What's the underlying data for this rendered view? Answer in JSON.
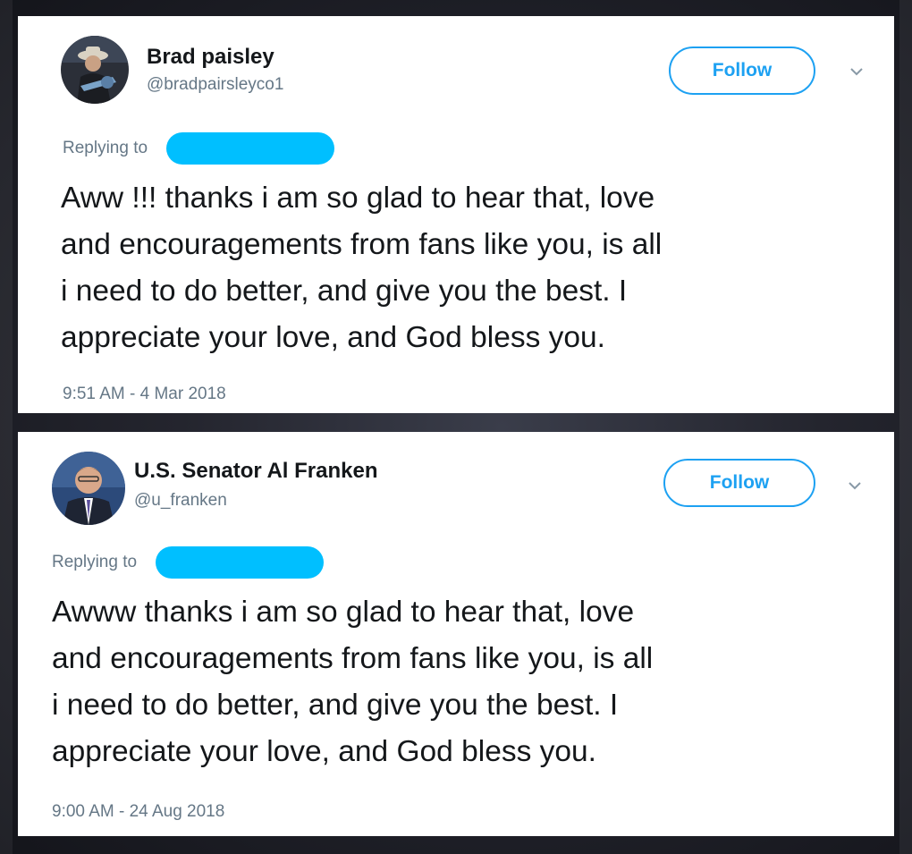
{
  "tweets": [
    {
      "display_name": "Brad paisley",
      "handle": "@bradpairsleyco1",
      "follow_label": "Follow",
      "replying_label": "Replying to",
      "text_lines": [
        "Aww !!! thanks i am so glad to hear that, love",
        "and encouragements from fans like you, is all",
        "i need to do better, and give you the best. I",
        "appreciate your love, and God bless you."
      ],
      "timestamp": "9:51 AM - 4 Mar 2018",
      "avatar_icon": "person-with-guitar-avatar"
    },
    {
      "display_name": "U.S. Senator Al Franken",
      "handle": "@u_franken",
      "follow_label": "Follow",
      "replying_label": "Replying to",
      "text_lines": [
        "Awww  thanks i am so glad to hear that, love",
        "and encouragements from fans like you, is all",
        "i need to do better, and give you the best. I",
        "appreciate your love, and God bless you."
      ],
      "timestamp": "9:00 AM - 24 Aug 2018",
      "avatar_icon": "man-in-suit-avatar"
    }
  ],
  "colors": {
    "accent": "#1da1f2",
    "redaction": "#00bfff",
    "text": "#14171a",
    "muted": "#657786"
  }
}
